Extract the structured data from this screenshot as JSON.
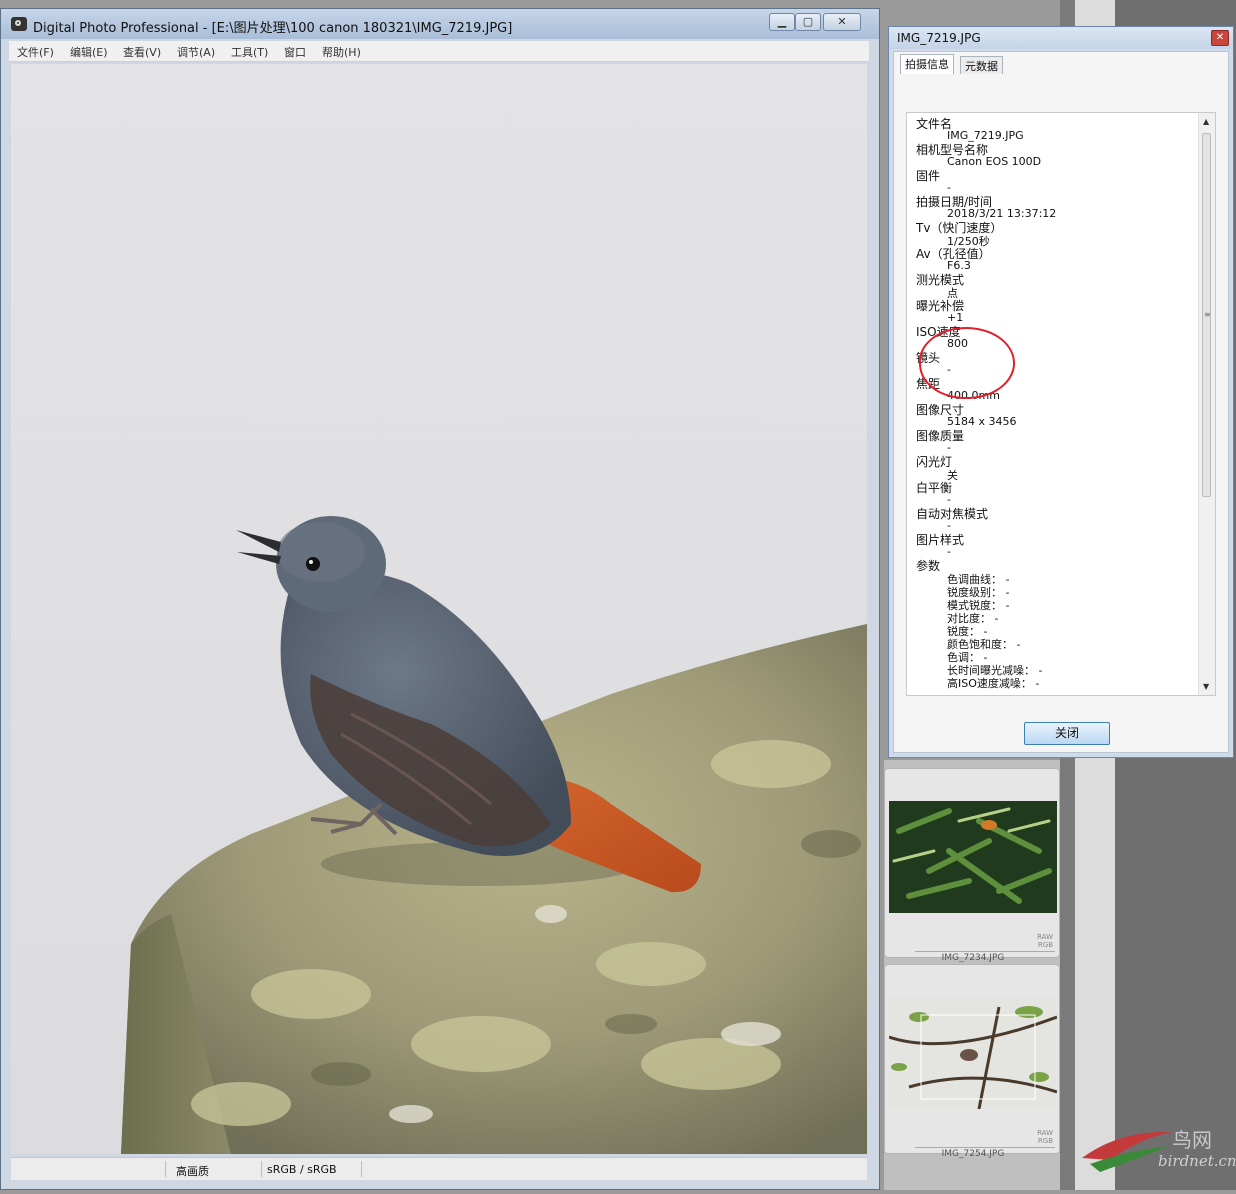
{
  "main_window": {
    "title": "Digital Photo Professional - [E:\\图片处理\\100 canon 180321\\IMG_7219.JPG]",
    "caption_buttons": {
      "minimize": "▁",
      "maximize": "▢",
      "close": "✕"
    },
    "menu": [
      "文件(F)",
      "编辑(E)",
      "查看(V)",
      "调节(A)",
      "工具(T)",
      "窗口",
      "帮助(H)"
    ],
    "status": {
      "quality": "高画质",
      "color_space": "sRGB / sRGB"
    }
  },
  "info_dialog": {
    "title": "IMG_7219.JPG",
    "close_x": "✕",
    "tabs": [
      "拍摄信息",
      "元数据"
    ],
    "fields": [
      {
        "label": "文件名",
        "value": "IMG_7219.JPG"
      },
      {
        "label": "相机型号名称",
        "value": "Canon EOS 100D"
      },
      {
        "label": "固件",
        "value": "-"
      },
      {
        "label": "拍摄日期/时间",
        "value": "2018/3/21 13:37:12"
      },
      {
        "label": "Tv（快门速度）",
        "value": "1/250秒"
      },
      {
        "label": "Av（孔径值）",
        "value": "F6.3"
      },
      {
        "label": "测光模式",
        "value": "点"
      },
      {
        "label": "曝光补偿",
        "value": "+1"
      },
      {
        "label": "ISO速度",
        "value": "800"
      },
      {
        "label": "镜头",
        "value": "-"
      },
      {
        "label": "焦距",
        "value": "400.0mm"
      },
      {
        "label": "图像尺寸",
        "value": "5184 x 3456"
      },
      {
        "label": "图像质量",
        "value": "-"
      },
      {
        "label": "闪光灯",
        "value": "关"
      },
      {
        "label": "白平衡",
        "value": "-"
      },
      {
        "label": "自动对焦模式",
        "value": "-"
      },
      {
        "label": "图片样式",
        "value": "-"
      },
      {
        "label": "参数",
        "value": ""
      }
    ],
    "parameters": [
      "色调曲线：  -",
      "锐度级别：  -",
      "模式锐度：  -",
      "对比度：  -",
      "锐度：  -",
      "颜色饱和度：  -",
      "色调：  -",
      "长时间曝光减噪：  -",
      "高ISO速度减噪：  -"
    ],
    "close_button": "关闭"
  },
  "thumbnails": [
    {
      "filename": "IMG_7234.JPG",
      "badge_raw": "RAW",
      "badge_rgb": "RGB"
    },
    {
      "filename": "IMG_7254.JPG",
      "badge_raw": "RAW",
      "badge_rgb": "RGB"
    }
  ],
  "watermark": {
    "cn": "鸟网",
    "en": "birdnet.cn"
  },
  "colors": {
    "annotation_red": "#e0202a",
    "bird_orange": "#c85a25",
    "bird_gray": "#55606f"
  }
}
